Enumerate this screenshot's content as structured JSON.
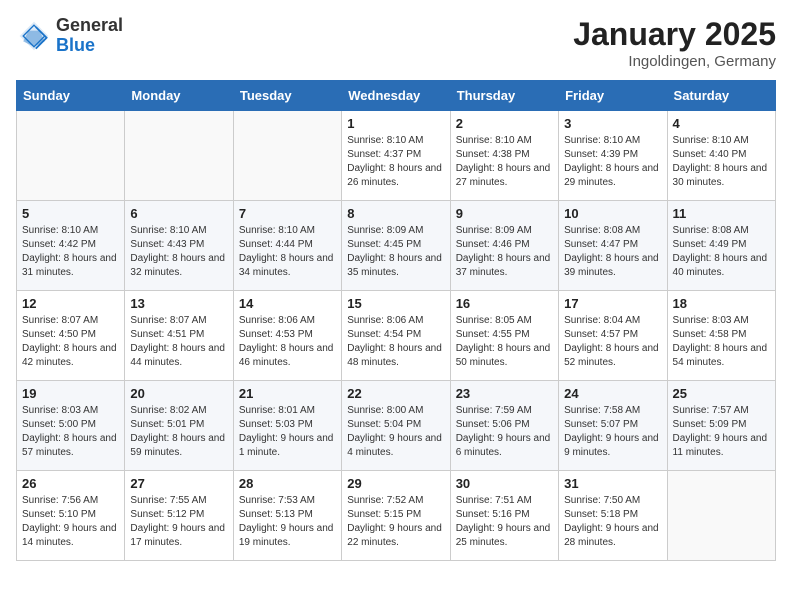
{
  "header": {
    "logo_general": "General",
    "logo_blue": "Blue",
    "title": "January 2025",
    "subtitle": "Ingoldingen, Germany"
  },
  "days_of_week": [
    "Sunday",
    "Monday",
    "Tuesday",
    "Wednesday",
    "Thursday",
    "Friday",
    "Saturday"
  ],
  "weeks": [
    [
      {
        "day": "",
        "info": ""
      },
      {
        "day": "",
        "info": ""
      },
      {
        "day": "",
        "info": ""
      },
      {
        "day": "1",
        "info": "Sunrise: 8:10 AM\nSunset: 4:37 PM\nDaylight: 8 hours and 26 minutes."
      },
      {
        "day": "2",
        "info": "Sunrise: 8:10 AM\nSunset: 4:38 PM\nDaylight: 8 hours and 27 minutes."
      },
      {
        "day": "3",
        "info": "Sunrise: 8:10 AM\nSunset: 4:39 PM\nDaylight: 8 hours and 29 minutes."
      },
      {
        "day": "4",
        "info": "Sunrise: 8:10 AM\nSunset: 4:40 PM\nDaylight: 8 hours and 30 minutes."
      }
    ],
    [
      {
        "day": "5",
        "info": "Sunrise: 8:10 AM\nSunset: 4:42 PM\nDaylight: 8 hours and 31 minutes."
      },
      {
        "day": "6",
        "info": "Sunrise: 8:10 AM\nSunset: 4:43 PM\nDaylight: 8 hours and 32 minutes."
      },
      {
        "day": "7",
        "info": "Sunrise: 8:10 AM\nSunset: 4:44 PM\nDaylight: 8 hours and 34 minutes."
      },
      {
        "day": "8",
        "info": "Sunrise: 8:09 AM\nSunset: 4:45 PM\nDaylight: 8 hours and 35 minutes."
      },
      {
        "day": "9",
        "info": "Sunrise: 8:09 AM\nSunset: 4:46 PM\nDaylight: 8 hours and 37 minutes."
      },
      {
        "day": "10",
        "info": "Sunrise: 8:08 AM\nSunset: 4:47 PM\nDaylight: 8 hours and 39 minutes."
      },
      {
        "day": "11",
        "info": "Sunrise: 8:08 AM\nSunset: 4:49 PM\nDaylight: 8 hours and 40 minutes."
      }
    ],
    [
      {
        "day": "12",
        "info": "Sunrise: 8:07 AM\nSunset: 4:50 PM\nDaylight: 8 hours and 42 minutes."
      },
      {
        "day": "13",
        "info": "Sunrise: 8:07 AM\nSunset: 4:51 PM\nDaylight: 8 hours and 44 minutes."
      },
      {
        "day": "14",
        "info": "Sunrise: 8:06 AM\nSunset: 4:53 PM\nDaylight: 8 hours and 46 minutes."
      },
      {
        "day": "15",
        "info": "Sunrise: 8:06 AM\nSunset: 4:54 PM\nDaylight: 8 hours and 48 minutes."
      },
      {
        "day": "16",
        "info": "Sunrise: 8:05 AM\nSunset: 4:55 PM\nDaylight: 8 hours and 50 minutes."
      },
      {
        "day": "17",
        "info": "Sunrise: 8:04 AM\nSunset: 4:57 PM\nDaylight: 8 hours and 52 minutes."
      },
      {
        "day": "18",
        "info": "Sunrise: 8:03 AM\nSunset: 4:58 PM\nDaylight: 8 hours and 54 minutes."
      }
    ],
    [
      {
        "day": "19",
        "info": "Sunrise: 8:03 AM\nSunset: 5:00 PM\nDaylight: 8 hours and 57 minutes."
      },
      {
        "day": "20",
        "info": "Sunrise: 8:02 AM\nSunset: 5:01 PM\nDaylight: 8 hours and 59 minutes."
      },
      {
        "day": "21",
        "info": "Sunrise: 8:01 AM\nSunset: 5:03 PM\nDaylight: 9 hours and 1 minute."
      },
      {
        "day": "22",
        "info": "Sunrise: 8:00 AM\nSunset: 5:04 PM\nDaylight: 9 hours and 4 minutes."
      },
      {
        "day": "23",
        "info": "Sunrise: 7:59 AM\nSunset: 5:06 PM\nDaylight: 9 hours and 6 minutes."
      },
      {
        "day": "24",
        "info": "Sunrise: 7:58 AM\nSunset: 5:07 PM\nDaylight: 9 hours and 9 minutes."
      },
      {
        "day": "25",
        "info": "Sunrise: 7:57 AM\nSunset: 5:09 PM\nDaylight: 9 hours and 11 minutes."
      }
    ],
    [
      {
        "day": "26",
        "info": "Sunrise: 7:56 AM\nSunset: 5:10 PM\nDaylight: 9 hours and 14 minutes."
      },
      {
        "day": "27",
        "info": "Sunrise: 7:55 AM\nSunset: 5:12 PM\nDaylight: 9 hours and 17 minutes."
      },
      {
        "day": "28",
        "info": "Sunrise: 7:53 AM\nSunset: 5:13 PM\nDaylight: 9 hours and 19 minutes."
      },
      {
        "day": "29",
        "info": "Sunrise: 7:52 AM\nSunset: 5:15 PM\nDaylight: 9 hours and 22 minutes."
      },
      {
        "day": "30",
        "info": "Sunrise: 7:51 AM\nSunset: 5:16 PM\nDaylight: 9 hours and 25 minutes."
      },
      {
        "day": "31",
        "info": "Sunrise: 7:50 AM\nSunset: 5:18 PM\nDaylight: 9 hours and 28 minutes."
      },
      {
        "day": "",
        "info": ""
      }
    ]
  ]
}
